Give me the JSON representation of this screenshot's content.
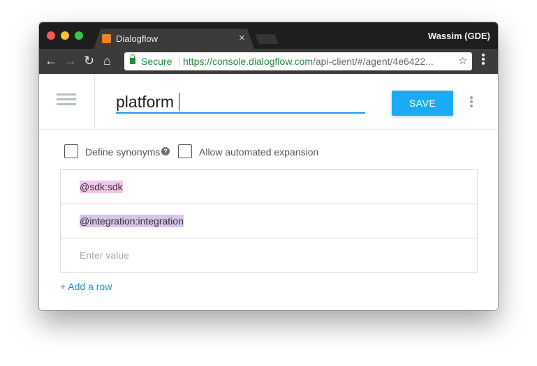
{
  "browser": {
    "tab_title": "Dialogflow",
    "tab_close": "×",
    "profile_name": "Wassim (GDE)",
    "secure_label": "Secure",
    "url_host": "https://console.dialogflow.com",
    "url_rest": "/api-client/#/agent/4e6422...",
    "nav": {
      "back": "←",
      "forward": "→",
      "reload": "↻",
      "home": "⌂",
      "star": "☆",
      "menu": "⋮"
    },
    "colors": {
      "close": "#fc5753",
      "minimize": "#fdbc40",
      "maximize": "#34c84a",
      "secure": "#1e8e3e"
    }
  },
  "header": {
    "entity_name": "platform",
    "save_label": "SAVE",
    "accent": "#1aabf3"
  },
  "options": {
    "define_synonyms_label": "Define synonyms",
    "define_synonyms_checked": false,
    "help_glyph": "?",
    "allow_expansion_label": "Allow automated expansion",
    "allow_expansion_checked": false
  },
  "rows": [
    {
      "value": "@sdk:sdk",
      "highlight": "#f3c6ec"
    },
    {
      "value": "@integration:integration",
      "highlight": "#d8c5ea"
    }
  ],
  "new_row": {
    "placeholder": "Enter value"
  },
  "add_row_label": "+ Add a row"
}
